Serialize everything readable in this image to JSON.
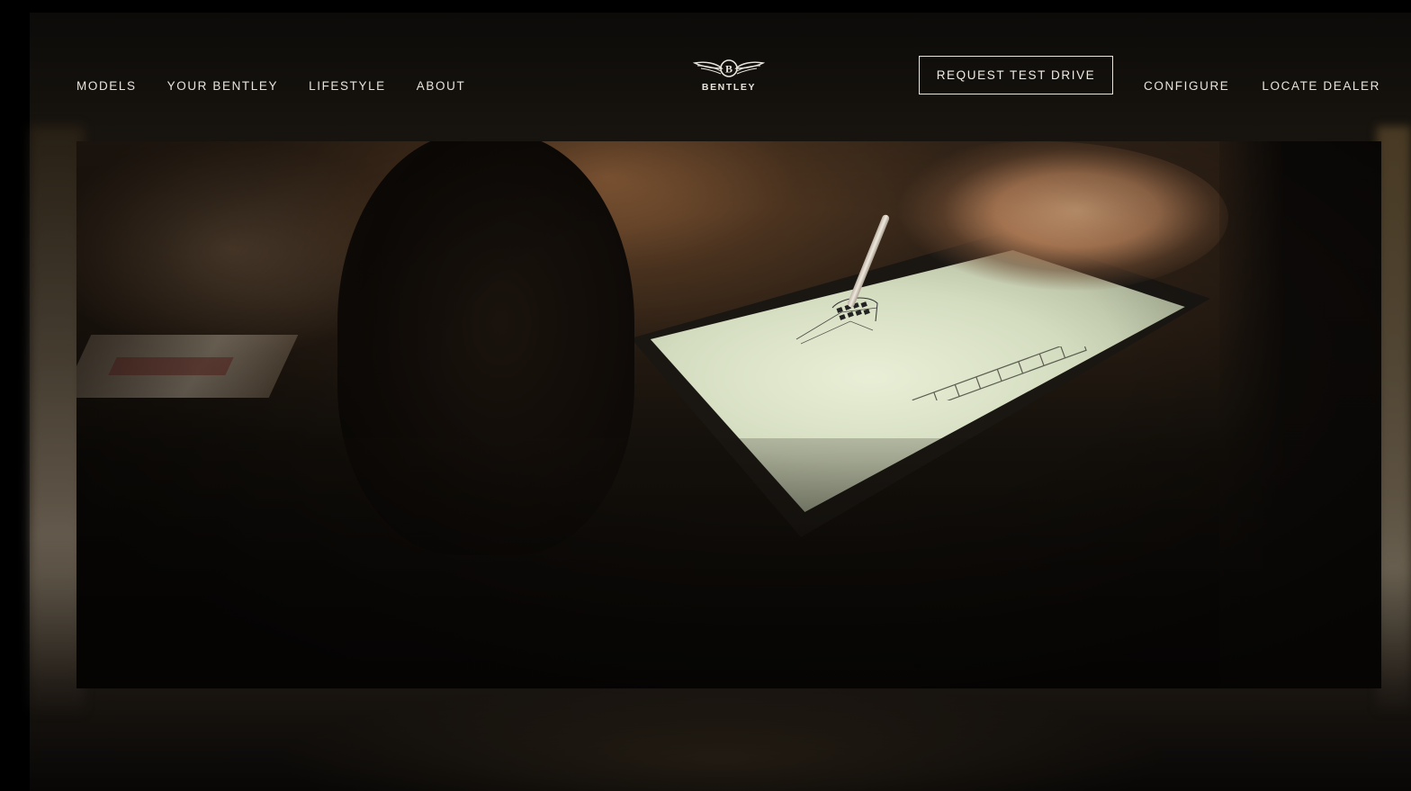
{
  "header": {
    "nav_left": [
      "MODELS",
      "YOUR BENTLEY",
      "LIFESTYLE",
      "ABOUT"
    ],
    "logo_text": "BENTLEY",
    "cta_label": "REQUEST TEST DRIVE",
    "nav_right": [
      "CONFIGURE",
      "LOCATE DEALER"
    ]
  },
  "hero": {
    "media_type": "video",
    "icon": "bentley-winged-b-logo"
  },
  "colors": {
    "text": "#e8e4dc",
    "background": "#000000",
    "cta_border": "#e8e4dc"
  }
}
